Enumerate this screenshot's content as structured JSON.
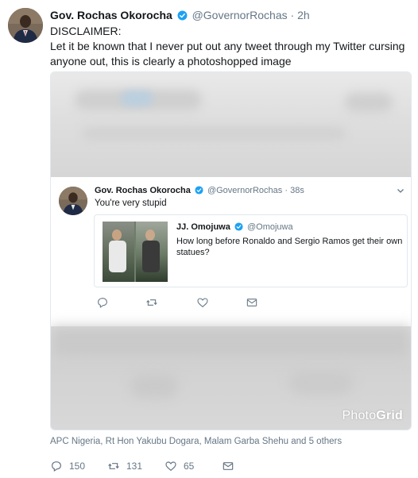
{
  "tweet": {
    "author_name": "Gov. Rochas Okorocha",
    "handle": "@GovernorRochas",
    "separator": "·",
    "time": "2h",
    "text_lines": [
      "DISCLAIMER:",
      "Let it be known that I never put out any tweet through my Twitter cursing",
      "anyone out, this is clearly a photoshopped image"
    ]
  },
  "media": {
    "watermark_light": "Photo",
    "watermark_bold": "Grid",
    "inner_tweet": {
      "author_name": "Gov. Rochas Okorocha",
      "handle": "@GovernorRochas",
      "separator": "·",
      "time": "38s",
      "text": "You're very stupid",
      "quoted": {
        "author_name": "JJ. Omojuwa",
        "handle": "@Omojuwa",
        "text": "How long  before Ronaldo and Sergio Ramos get their own statues?"
      }
    }
  },
  "liked_by": "APC Nigeria, Rt Hon Yakubu Dogara, Malam Garba Shehu and 5 others",
  "actions": {
    "reply_count": "150",
    "retweet_count": "131",
    "like_count": "65"
  },
  "colors": {
    "verified": "#1da1f2",
    "muted": "#657786",
    "text": "#14171a",
    "border": "#e1e8ed"
  }
}
